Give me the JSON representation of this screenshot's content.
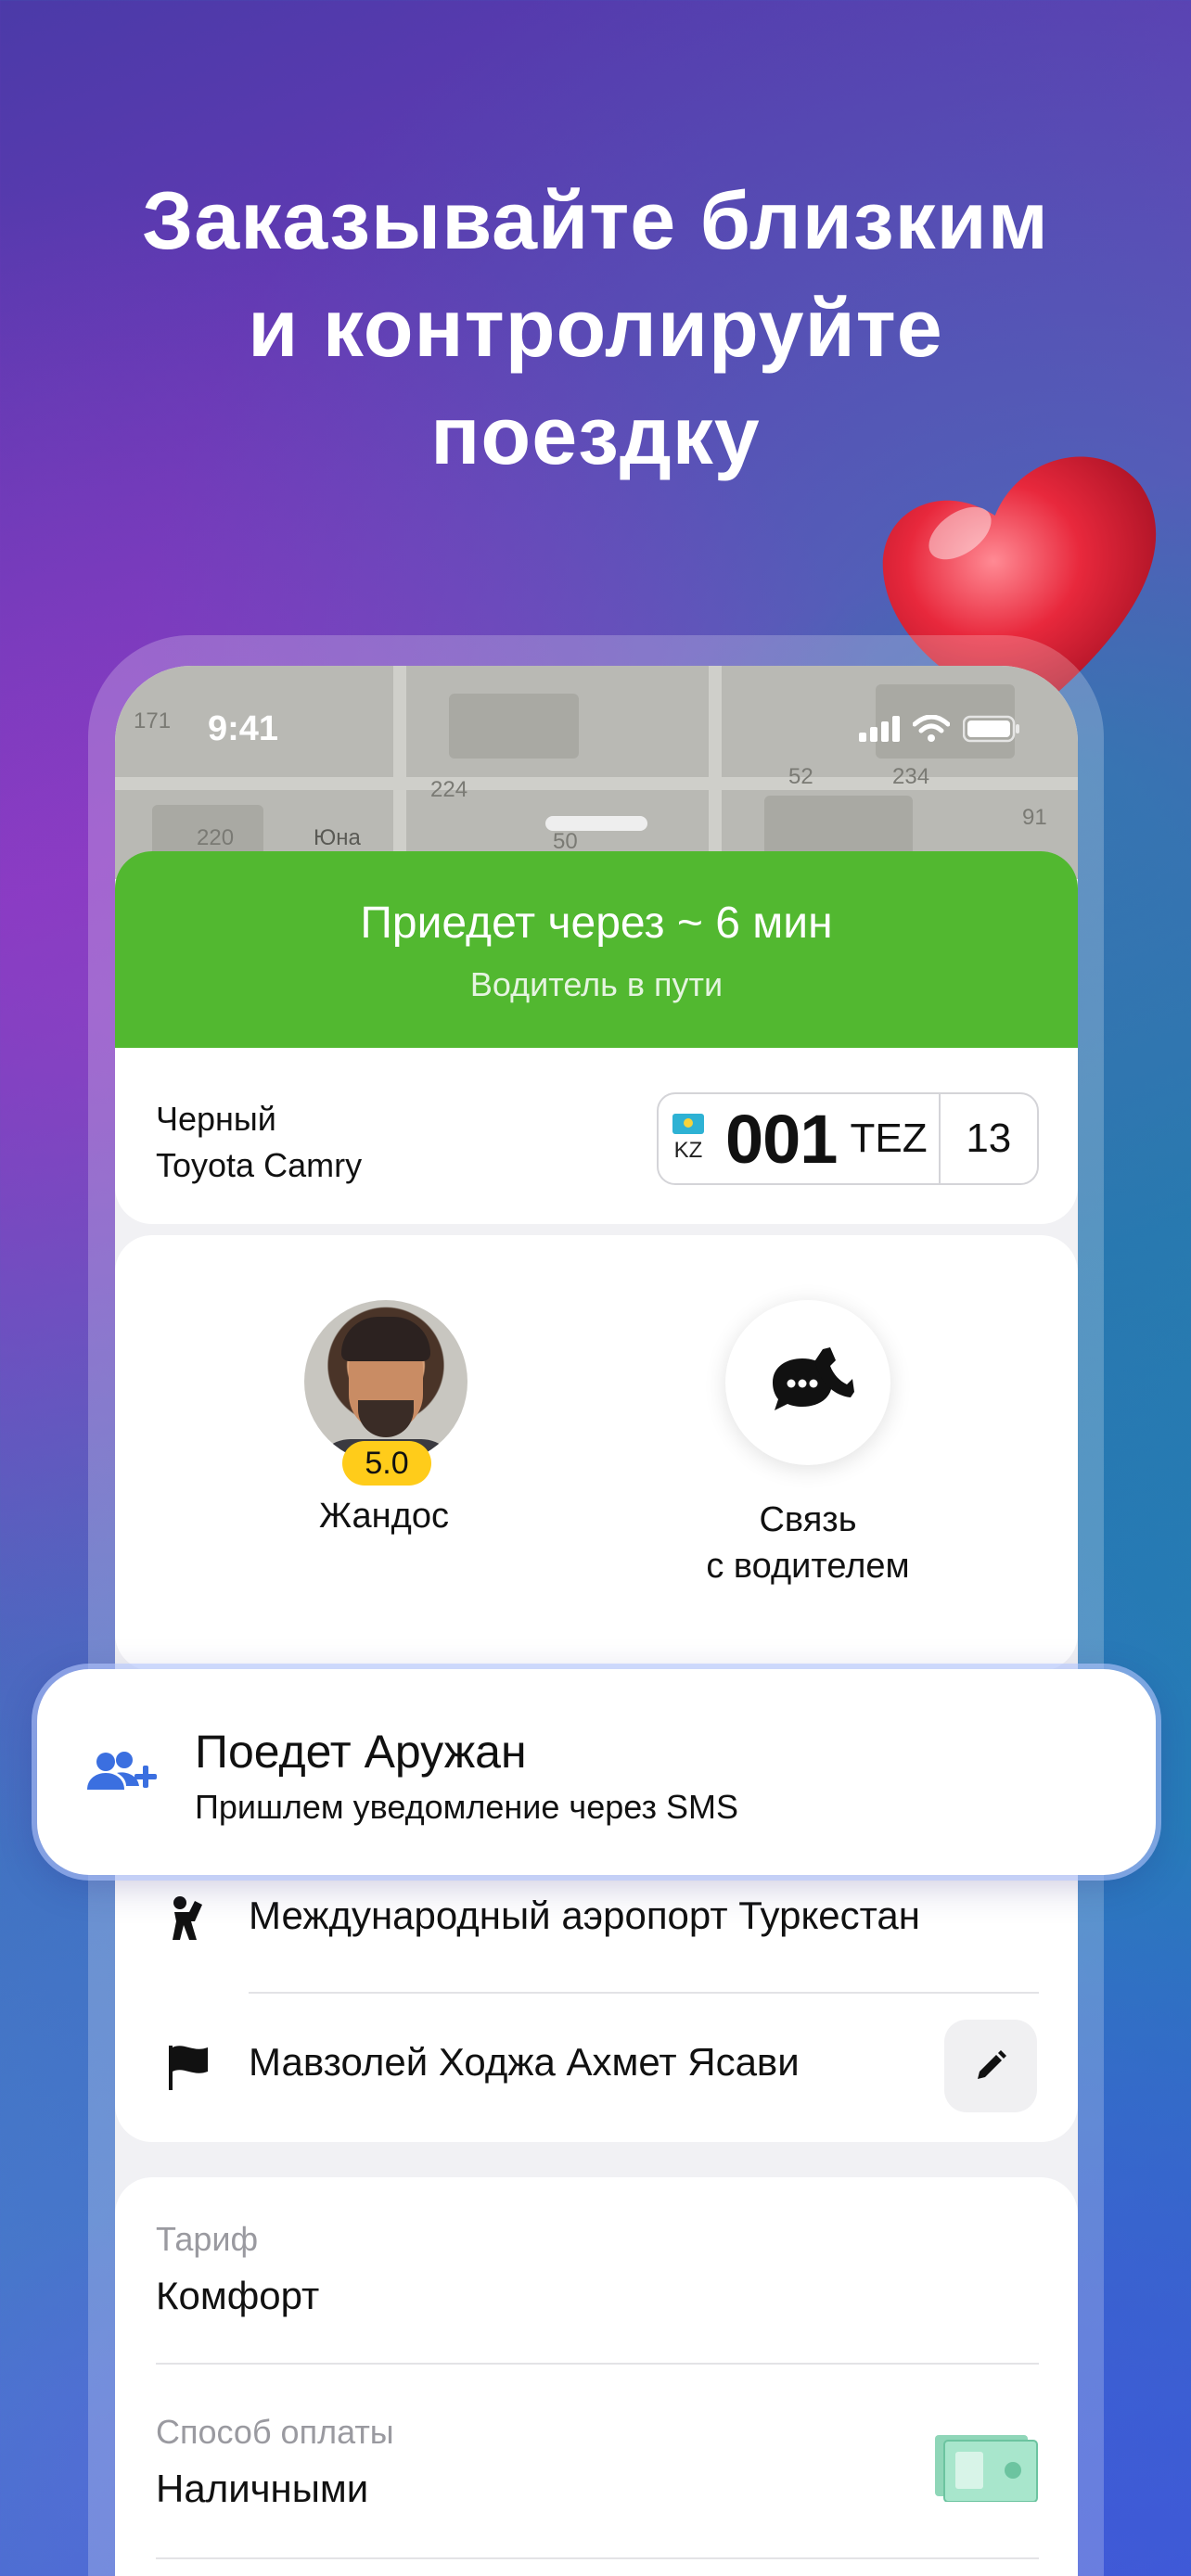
{
  "headline": {
    "line1": "Заказывайте близким",
    "line2": "и контролируйте",
    "line3": "поездку"
  },
  "status_bar": {
    "time": "9:41"
  },
  "map": {
    "labels": [
      "220",
      "Юна",
      "50",
      "224",
      "52",
      "234",
      "91",
      "171"
    ]
  },
  "eta": {
    "title": "Приедет через ~ 6 мин",
    "subtitle": "Водитель в пути"
  },
  "car": {
    "color": "Черный",
    "model": "Toyota Camry",
    "plate": {
      "country": "KZ",
      "number": "001",
      "series": "TEZ",
      "region": "13"
    }
  },
  "driver": {
    "name": "Жандос",
    "rating": "5.0",
    "call_line1": "Связь",
    "call_line2": "с водителем"
  },
  "rider": {
    "title": "Поедет Аружан",
    "subtitle": "Пришлем уведомление через SMS"
  },
  "route": {
    "from": "Международный аэропорт Туркестан",
    "to": "Мавзолей Ходжа Ахмет Ясави"
  },
  "info": {
    "tariff_label": "Тариф",
    "tariff_value": "Комфорт",
    "payment_label": "Способ оплаты",
    "payment_value": "Наличными"
  },
  "colors": {
    "eta_green": "#52b830",
    "rating_yellow": "#ffcc1a",
    "rider_icon_blue": "#3b6fe0"
  },
  "icons": [
    "heart-icon",
    "signal-icon",
    "wifi-icon",
    "battery-icon",
    "chat-phone-icon",
    "add-user-icon",
    "pickup-person-icon",
    "finish-flag-icon",
    "pencil-icon",
    "cash-icon"
  ]
}
